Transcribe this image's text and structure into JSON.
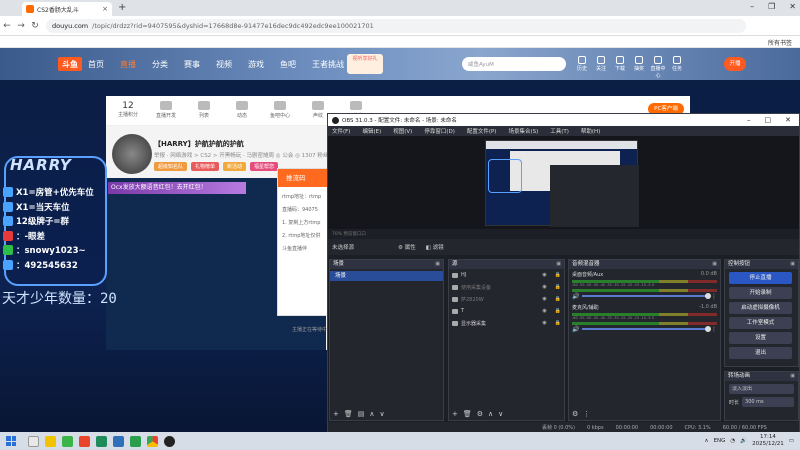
{
  "browser": {
    "tab_title": "CS2香肠大乱斗",
    "url_host": "douyu.com",
    "url_path": "/topic/drdzz?rid=9407595&dyshid=17668d8e-91477e16dec9dc492edc9ee100021701",
    "bookmark_label": "所有书签"
  },
  "site": {
    "logo": "斗鱼",
    "nav": [
      "首页",
      "直播",
      "分类",
      "赛事",
      "视频",
      "游戏",
      "鱼吧",
      "王者挑战"
    ],
    "nav_active_index": 1,
    "live_badge": "视听享好礼",
    "search_placeholder": "咸鱼AyuM",
    "header_icons": [
      "历史",
      "关注",
      "下载",
      "抽奖",
      "直播中心",
      "任务"
    ],
    "open_live": "开播"
  },
  "room": {
    "top_stats": [
      {
        "num": "12",
        "label": "主播积分"
      },
      {
        "num": "",
        "label": "直播开发"
      },
      {
        "num": "",
        "label": "列表"
      },
      {
        "num": "",
        "label": "动态"
      },
      {
        "num": "",
        "label": "鱼吧中心"
      },
      {
        "num": "",
        "label": "声纹"
      },
      {
        "num": "",
        "label": "AI礼包"
      }
    ],
    "pc_badge": "PC客户端",
    "title": "【HARRY】护航护航的护航",
    "meta": "举报 · 网络游戏 > CS2 > 开黑畅玩 · 马剧密摊周  ◎ 公会  ◎ 1307 粉丝  ◎ 100 粉丝团",
    "tags": [
      "超级知名队",
      "礼物榜单",
      "新活动",
      "福星帮您"
    ],
    "banner": "Ocx发放大额语音红包！去开红包！",
    "popup_head": "推流码",
    "popup_rows": [
      "rtmp地址：rtmp",
      "直播码：94075",
      "1. 复制上方rtmp",
      "2. rtmp地址仅供",
      "斗鱼直播伴"
    ],
    "foot_note": "主播正在等待中"
  },
  "overlay": {
    "name": "HARRY",
    "lines": [
      "X1=房管+优先车位",
      "X1=当天车位",
      "12级牌子=群",
      "：-眼差",
      "：snowy1023~",
      "：492545632"
    ],
    "count_line": "天才少年数量：20"
  },
  "obs": {
    "title": "OBS 31.0.3 - 配置文件: 未命名 - 场景: 未命名",
    "menu": [
      "文件(F)",
      "编辑(E)",
      "视图(V)",
      "停靠窗口(D)",
      "配置文件(P)",
      "场景集合(S)",
      "工具(T)",
      "帮助(H)"
    ],
    "ruler_text": "70%  预览窗口口",
    "no_source": "未选择源",
    "props_btn": "属性",
    "filters_btn": "滤镜",
    "scenes_title": "场景",
    "scenes": [
      "场景"
    ],
    "sources_title": "源",
    "sources": [
      {
        "name": "HJ",
        "dim": false
      },
      {
        "name": "使用采集设备",
        "dim": true
      },
      {
        "name": "萨2820W",
        "dim": true
      },
      {
        "name": "T",
        "dim": false
      },
      {
        "name": "显示器采集",
        "dim": false
      }
    ],
    "mixer_title": "音频混音器",
    "mixer": [
      {
        "name": "桌面音频/Aux",
        "db": "0.0 dB"
      },
      {
        "name": "麦克风/辅助",
        "db": "-1.0 dB"
      }
    ],
    "meter_scale": "-60 -55 -50 -45 -40 -35 -30 -25 -20 -15 -10 -5 0",
    "controls_title": "控制按钮",
    "controls": [
      "停止直播",
      "开始录制",
      "启动虚拟摄像机",
      "工作室模式",
      "设置",
      "退出"
    ],
    "transitions_title": "转场动画",
    "transition_type": "淡入淡出",
    "duration_label": "时长",
    "duration": "300 ms",
    "status": [
      "丢帧 0 (0.0%)",
      "0 kbps",
      "00:00:00",
      "00:00:00",
      "CPU: 3.1%",
      "60.00 / 60.00 FPS"
    ]
  },
  "taskbar": {
    "lang": "ENG",
    "time": "17:14",
    "date": "2025/12/21"
  },
  "colors": {
    "accent": "#ff6a1f",
    "obs_blue": "#2a57c4"
  }
}
